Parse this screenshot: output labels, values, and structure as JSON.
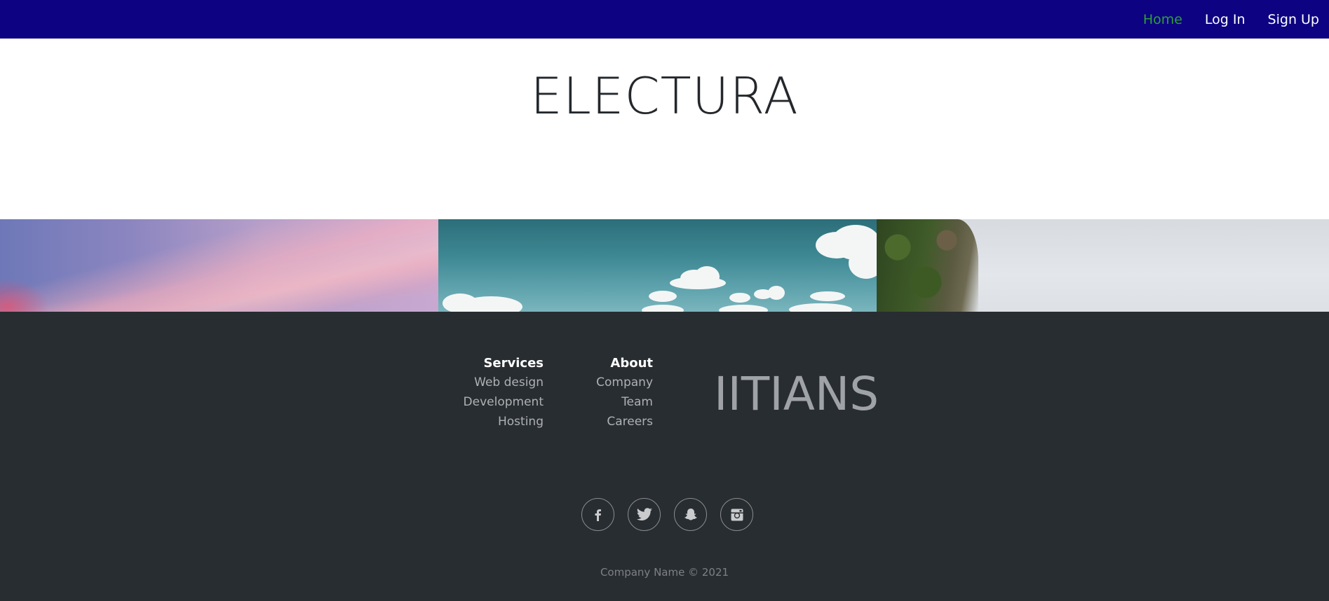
{
  "navbar": {
    "links": [
      {
        "label": "Home",
        "active": true
      },
      {
        "label": "Log In",
        "active": false
      },
      {
        "label": "Sign Up",
        "active": false
      }
    ],
    "background": "#0d0282",
    "active_color": "#2e9e3a"
  },
  "hero": {
    "title": "ELECTURA"
  },
  "image_strip": {
    "images": [
      "sunset-sky-image",
      "cloudy-sky-image",
      "cliff-sky-image"
    ]
  },
  "footer": {
    "background": "#282d31",
    "services": {
      "heading": "Services",
      "links": [
        "Web design",
        "Development",
        "Hosting"
      ]
    },
    "about": {
      "heading": "About",
      "links": [
        "Company",
        "Team",
        "Careers"
      ]
    },
    "brand": "IITIANS",
    "social": [
      "facebook-icon",
      "twitter-icon",
      "snapchat-icon",
      "instagram-icon"
    ],
    "copyright": "Company Name © 2021"
  }
}
